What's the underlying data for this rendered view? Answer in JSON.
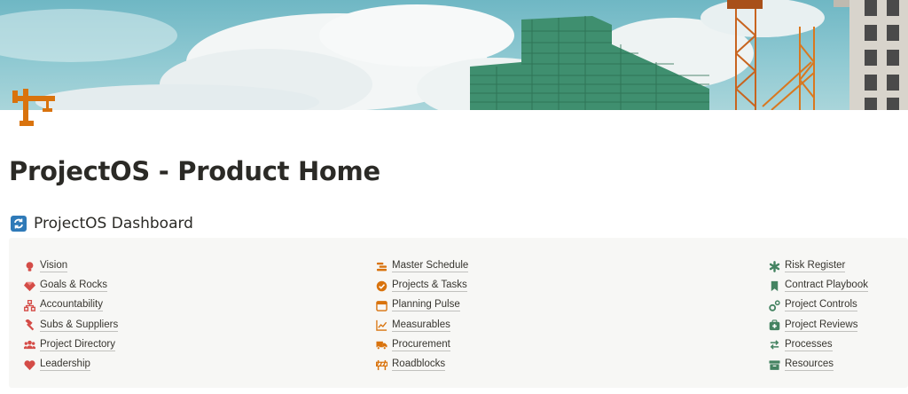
{
  "page": {
    "title": "ProjectOS - Product Home",
    "icon": "crane-icon",
    "cover": "construction-site-cover"
  },
  "section": {
    "title": "ProjectOS Dashboard",
    "icon": "sync-icon"
  },
  "columns": [
    [
      {
        "label": "Vision",
        "icon": "lightbulb-icon",
        "color": "#d44c47"
      },
      {
        "label": "Goals & Rocks",
        "icon": "gem-icon",
        "color": "#d44c47"
      },
      {
        "label": "Accountability",
        "icon": "org-chart-icon",
        "color": "#d44c47"
      },
      {
        "label": "Subs & Suppliers",
        "icon": "hammer-icon",
        "color": "#d44c47"
      },
      {
        "label": "Project Directory",
        "icon": "users-icon",
        "color": "#d44c47"
      },
      {
        "label": "Leadership",
        "icon": "heart-icon",
        "color": "#d44c47"
      }
    ],
    [
      {
        "label": "Master Schedule",
        "icon": "timeline-icon",
        "color": "#d9730d"
      },
      {
        "label": "Projects & Tasks",
        "icon": "check-circle-icon",
        "color": "#d9730d"
      },
      {
        "label": "Planning Pulse",
        "icon": "calendar-icon",
        "color": "#d9730d"
      },
      {
        "label": "Measurables",
        "icon": "line-chart-icon",
        "color": "#d9730d"
      },
      {
        "label": "Procurement",
        "icon": "truck-icon",
        "color": "#d9730d"
      },
      {
        "label": "Roadblocks",
        "icon": "barrier-icon",
        "color": "#d9730d"
      }
    ],
    [
      {
        "label": "Risk Register",
        "icon": "asterisk-icon",
        "color": "#448361"
      },
      {
        "label": "Contract Playbook",
        "icon": "bookmark-icon",
        "color": "#448361"
      },
      {
        "label": "Project Controls",
        "icon": "gears-icon",
        "color": "#448361"
      },
      {
        "label": "Project Reviews",
        "icon": "medkit-icon",
        "color": "#448361"
      },
      {
        "label": "Processes",
        "icon": "arrows-cycle-icon",
        "color": "#448361"
      },
      {
        "label": "Resources",
        "icon": "archive-icon",
        "color": "#448361"
      }
    ]
  ]
}
